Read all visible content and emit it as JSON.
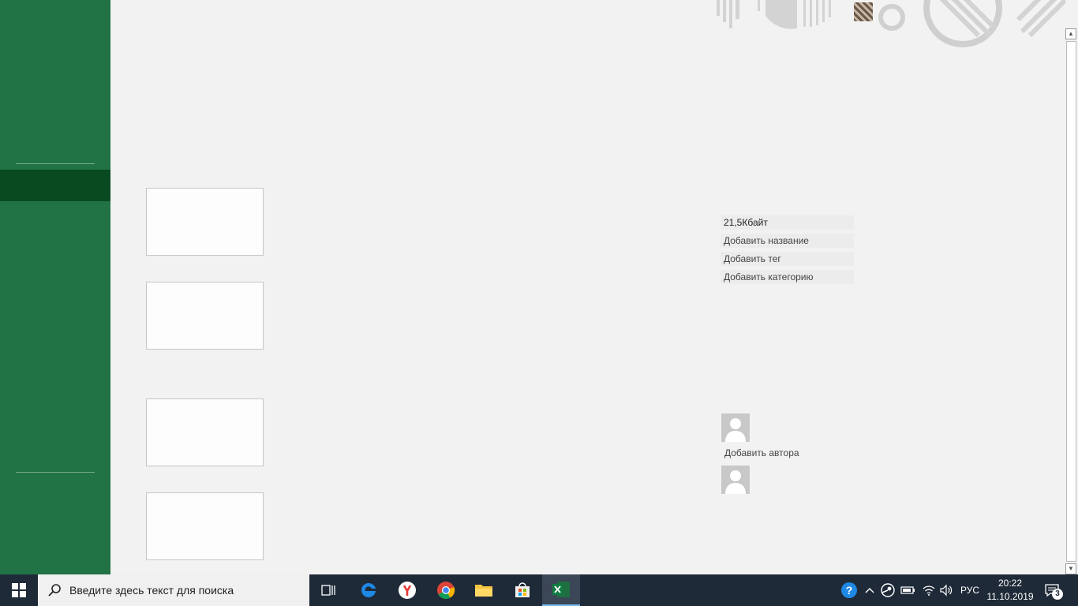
{
  "properties": {
    "size": "21,5Кбайт",
    "add_title": "Добавить название",
    "add_tag": "Добавить тег",
    "add_category": "Добавить категорию",
    "add_author": "Добавить автора"
  },
  "taskbar": {
    "search_placeholder": "Введите здесь текст для поиска",
    "icons": [
      "task-view-icon",
      "edge-icon",
      "yandex-browser-icon",
      "chrome-icon",
      "file-explorer-icon",
      "store-icon",
      "excel-icon"
    ],
    "tray": {
      "language": "РУС",
      "time": "20:22",
      "date": "11.10.2019",
      "notification_count": "3"
    }
  },
  "colors": {
    "sidebar": "#217346",
    "sidebar_selected": "#0a4a20",
    "taskbar": "#1f2a38",
    "background": "#f2f2f2"
  }
}
